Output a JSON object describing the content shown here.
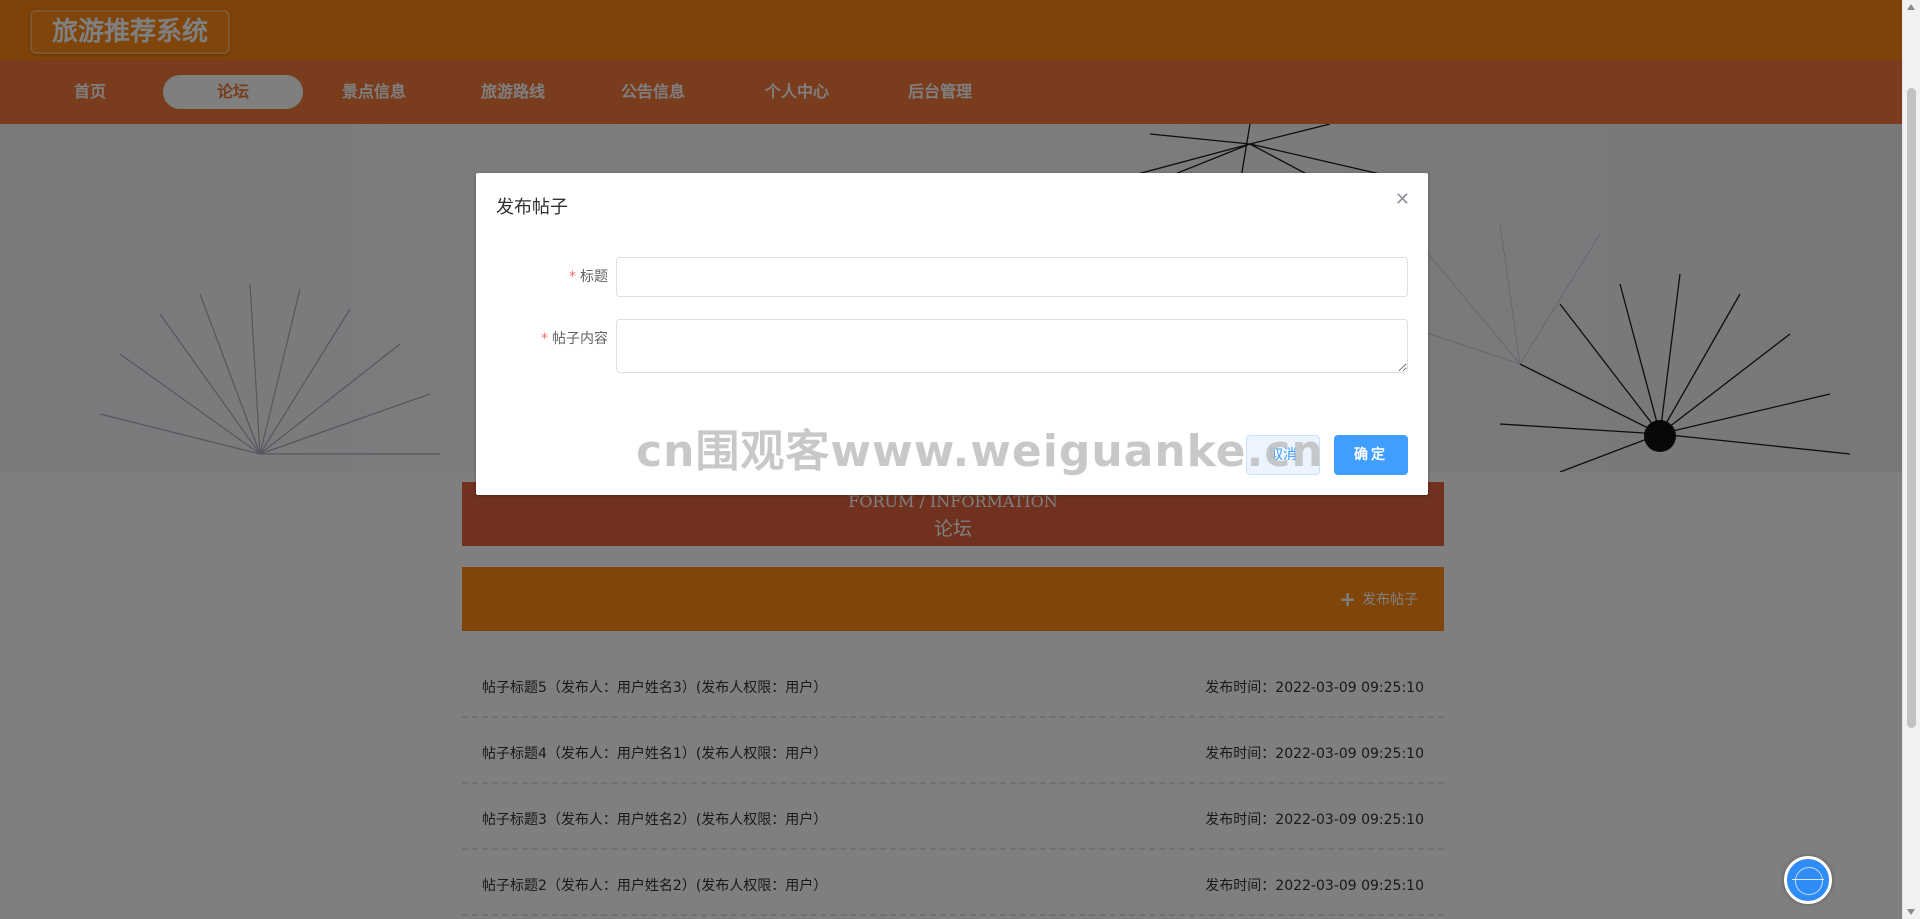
{
  "app": {
    "title": "旅游推荐系统"
  },
  "nav": {
    "items": [
      {
        "label": "首页"
      },
      {
        "label": "论坛",
        "active": true
      },
      {
        "label": "景点信息"
      },
      {
        "label": "旅游路线"
      },
      {
        "label": "公告信息"
      },
      {
        "label": "个人中心"
      },
      {
        "label": "后台管理"
      }
    ]
  },
  "section": {
    "title_en": "FORUM / INFORMATION",
    "title_zh": "论坛"
  },
  "toolbar": {
    "post_label": "发布帖子",
    "plus_icon": "plus-icon"
  },
  "posts": [
    {
      "title": "帖子标题5（发布人：用户姓名3）(发布人权限：用户）",
      "time": "发布时间：2022-03-09 09:25:10"
    },
    {
      "title": "帖子标题4（发布人：用户姓名1）(发布人权限：用户）",
      "time": "发布时间：2022-03-09 09:25:10"
    },
    {
      "title": "帖子标题3（发布人：用户姓名2）(发布人权限：用户）",
      "time": "发布时间：2022-03-09 09:25:10"
    },
    {
      "title": "帖子标题2（发布人：用户姓名2）(发布人权限：用户）",
      "time": "发布时间：2022-03-09 09:25:10"
    }
  ],
  "dialog": {
    "title": "发布帖子",
    "close_icon": "close-icon",
    "required_mark": "*",
    "fields": {
      "title_label": "标题",
      "title_value": "",
      "content_label": "帖子内容",
      "content_value": ""
    },
    "cancel_label": "取消",
    "ok_label": "确定"
  },
  "watermark": "cn围观客www.weiguanke.cn",
  "colors": {
    "topbar": "#ff8612",
    "navbar": "#f2783b",
    "section_title": "#e1643f",
    "post_bar": "#ff8a12",
    "primary": "#409eff"
  }
}
